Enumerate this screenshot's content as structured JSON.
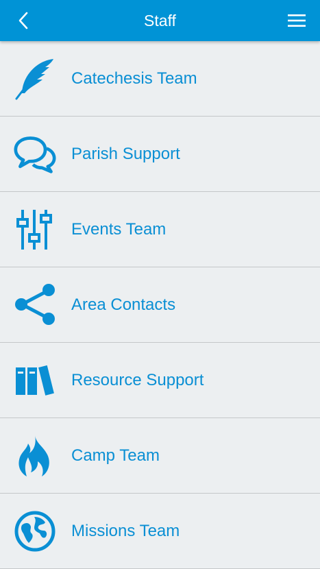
{
  "header": {
    "title": "Staff",
    "back_icon": "chevron-left-icon",
    "menu_icon": "hamburger-menu-icon"
  },
  "accent_color": "#0093d6",
  "items": [
    {
      "label": "Catechesis Team",
      "icon": "feather-quill-icon"
    },
    {
      "label": "Parish Support",
      "icon": "speech-bubbles-icon"
    },
    {
      "label": "Events Team",
      "icon": "sliders-icon"
    },
    {
      "label": "Area Contacts",
      "icon": "share-icon"
    },
    {
      "label": "Resource Support",
      "icon": "books-icon"
    },
    {
      "label": "Camp Team",
      "icon": "fire-icon"
    },
    {
      "label": "Missions Team",
      "icon": "globe-icon"
    }
  ]
}
